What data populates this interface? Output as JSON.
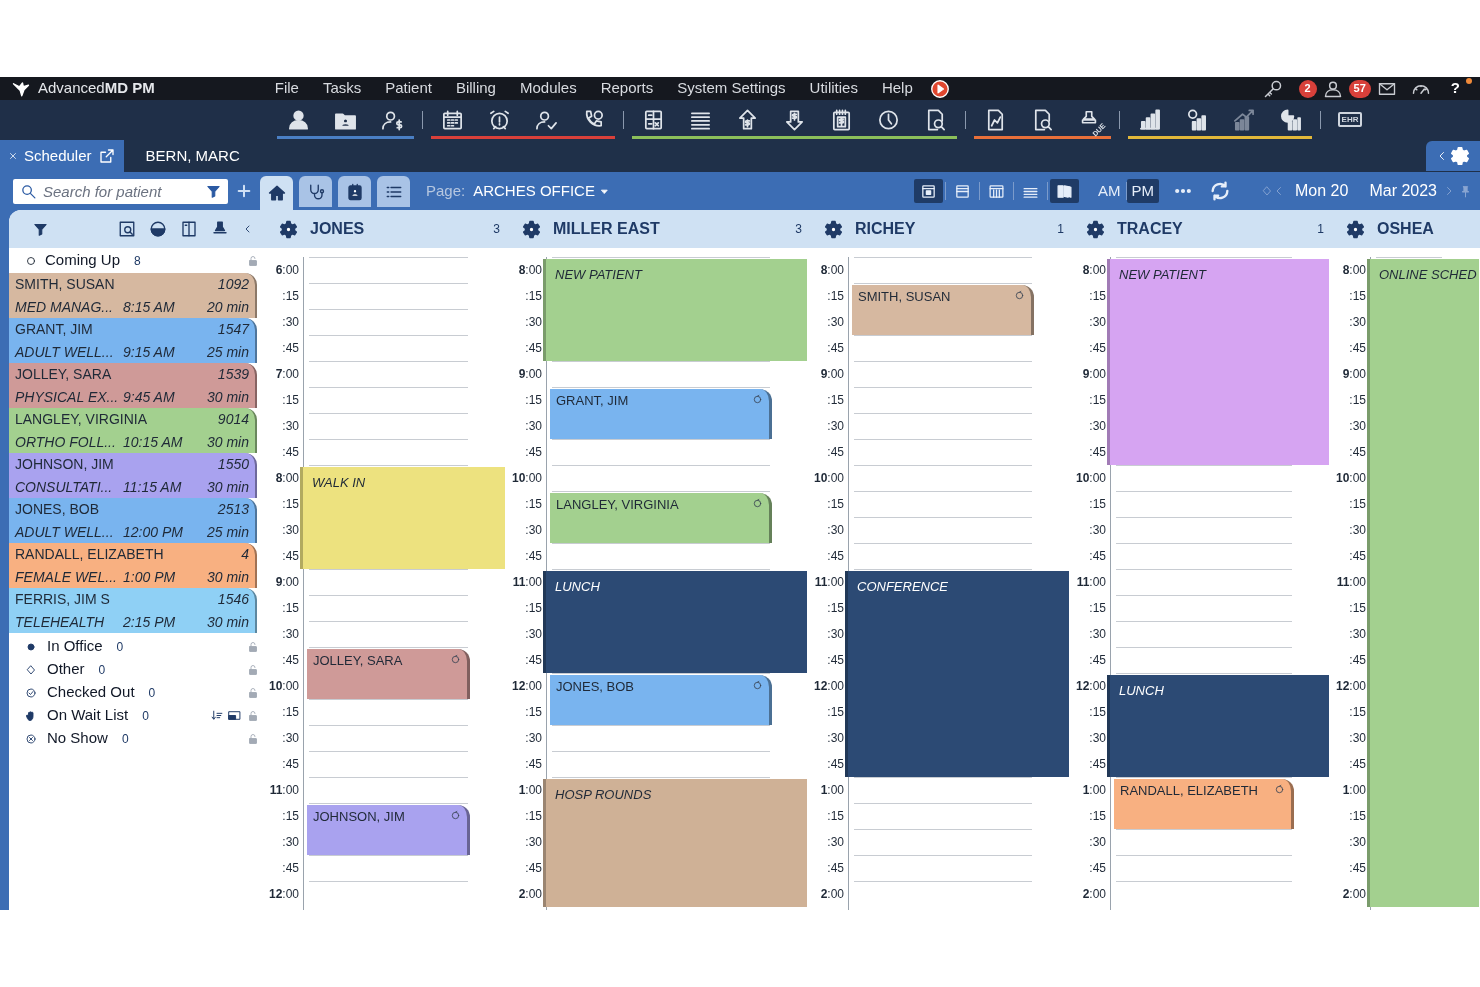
{
  "window": {
    "brand": "Advanced**MD PM**"
  },
  "menu": [
    "File",
    "Tasks",
    "Patient",
    "Billing",
    "Modules",
    "Reports",
    "System Settings",
    "Utilities",
    "Help"
  ],
  "alerts": {
    "tasks_badge": "2",
    "messages_badge": "57",
    "help": "?"
  },
  "toolbar": [
    {
      "color": "#4a7fc4",
      "items": [
        {
          "kind": "person"
        },
        {
          "kind": "folder"
        },
        {
          "kind": "user-dollar"
        }
      ]
    },
    {
      "color": "#d9403a",
      "items": [
        {
          "kind": "calendar"
        },
        {
          "kind": "alarm"
        },
        {
          "kind": "user-check"
        },
        {
          "kind": "phone"
        }
      ]
    },
    {
      "color": "#8bbf5a",
      "items": [
        {
          "kind": "calculator"
        },
        {
          "kind": "list"
        },
        {
          "kind": "upload"
        },
        {
          "kind": "download"
        },
        {
          "kind": "receipt"
        },
        {
          "kind": "clock"
        },
        {
          "kind": "doc-search"
        }
      ]
    },
    {
      "color": "#e8703a",
      "items": [
        {
          "kind": "doc-edit"
        },
        {
          "kind": "doc-search"
        },
        {
          "kind": "stamp",
          "label": "DUE"
        }
      ]
    },
    {
      "color": "#e2b83a",
      "items": [
        {
          "kind": "bars"
        },
        {
          "kind": "clock-bars"
        },
        {
          "kind": "trend"
        },
        {
          "kind": "pie-bars"
        }
      ]
    },
    {
      "items": [
        {
          "kind": "monitor",
          "label": "EHR"
        }
      ]
    }
  ],
  "tabs": [
    {
      "label": "Scheduler",
      "selected": true
    },
    {
      "label": "BERN, MARC",
      "selected": false
    }
  ],
  "search": {
    "placeholder": "Search for patient"
  },
  "views": [
    {
      "kind": "home",
      "selected": true
    },
    {
      "kind": "stethoscope",
      "selected": false
    },
    {
      "kind": "card",
      "selected": false
    },
    {
      "kind": "list",
      "selected": false
    }
  ],
  "page": {
    "label": "Page:",
    "value": "ARCHES OFFICE"
  },
  "layouts": [
    {
      "kind": "day",
      "selected": true
    },
    {
      "kind": "row",
      "selected": false
    },
    {
      "kind": "week",
      "selected": false
    },
    {
      "kind": "stack",
      "selected": false
    },
    {
      "kind": "book",
      "selected": true
    }
  ],
  "period": [
    {
      "label": "AM",
      "selected": false
    },
    {
      "label": "PM",
      "selected": true
    }
  ],
  "date": {
    "day": "Mon 20",
    "month": "Mar 2023"
  },
  "sidebar": {
    "coming_up": {
      "label": "Coming Up",
      "count": "8"
    },
    "appointments": [
      {
        "name": "SMITH, SUSAN",
        "number": "1092",
        "type": "MED MANAG...",
        "time": "8:15 AM",
        "duration": "20 min",
        "color": "#d6b8a0"
      },
      {
        "name": "GRANT, JIM",
        "number": "1547",
        "type": "ADULT WELL...",
        "time": "9:15 AM",
        "duration": "25 min",
        "color": "#79b4ef"
      },
      {
        "name": "JOLLEY, SARA",
        "number": "1539",
        "type": "PHYSICAL EX...",
        "time": "9:45 AM",
        "duration": "30 min",
        "color": "#cf9a98"
      },
      {
        "name": "LANGLEY, VIRGINIA",
        "number": "9014",
        "type": "ORTHO FOLL...",
        "time": "10:15 AM",
        "duration": "30 min",
        "color": "#a3d08f"
      },
      {
        "name": "JOHNSON, JIM",
        "number": "1550",
        "type": "CONSULTATI...",
        "time": "11:15 AM",
        "duration": "30 min",
        "color": "#a9a2ef"
      },
      {
        "name": "JONES, BOB",
        "number": "2513",
        "type": "ADULT WELL...",
        "time": "12:00 PM",
        "duration": "25 min",
        "color": "#79b4ef"
      },
      {
        "name": "RANDALL, ELIZABETH",
        "number": "4",
        "type": "FEMALE WEL...",
        "time": "1:00 PM",
        "duration": "30 min",
        "color": "#f8b081"
      },
      {
        "name": "FERRIS, JIM S",
        "number": "1546",
        "type": "TELEHEALTH",
        "time": "2:15 PM",
        "duration": "30 min",
        "color": "#8fd0f5"
      }
    ],
    "statuses": [
      {
        "kind": "dot",
        "label": "In Office",
        "count": "0"
      },
      {
        "kind": "diamond",
        "label": "Other",
        "count": "0"
      },
      {
        "kind": "check",
        "label": "Checked Out",
        "count": "0"
      },
      {
        "kind": "hand",
        "label": "On Wait List",
        "count": "0"
      },
      {
        "kind": "cross",
        "label": "No Show",
        "count": "0"
      }
    ]
  },
  "providers": [
    {
      "name": "JONES",
      "count": "3",
      "slots": [
        {
          "time": "**6**:00"
        },
        {
          "time": ":15"
        },
        {
          "time": ":30"
        },
        {
          "time": ":45"
        },
        {
          "time": "**7**:00"
        },
        {
          "time": ":15"
        },
        {
          "time": ":30"
        },
        {
          "time": ":45"
        },
        {
          "time": "**8**:00",
          "appointment": {
            "kind": "block",
            "label": "WALK IN",
            "color": "#ede27f"
          }
        },
        {
          "time": ":15",
          "continues": true
        },
        {
          "time": ":30",
          "continues": true
        },
        {
          "time": ":45",
          "continues": true
        },
        {
          "time": "**9**:00"
        },
        {
          "time": ":15"
        },
        {
          "time": ":30"
        },
        {
          "time": ":45",
          "appointment": {
            "kind": "patient",
            "label": "JOLLEY, SARA",
            "color": "#cf9a98"
          }
        },
        {
          "time": "**10**:00",
          "continues": true
        },
        {
          "time": ":15"
        },
        {
          "time": ":30"
        },
        {
          "time": ":45"
        },
        {
          "time": "**11**:00"
        },
        {
          "time": ":15",
          "appointment": {
            "kind": "patient",
            "label": "JOHNSON, JIM",
            "color": "#a9a2ef"
          }
        },
        {
          "time": ":30",
          "continues": true
        },
        {
          "time": ":45"
        },
        {
          "time": "**12**:00"
        }
      ]
    },
    {
      "name": "MILLER EAST",
      "count": "3",
      "slots": [
        {
          "time": "**8**:00",
          "appointment": {
            "kind": "block",
            "label": "NEW PATIENT",
            "color": "#a3d08f"
          }
        },
        {
          "time": ":15",
          "continues": true
        },
        {
          "time": ":30",
          "continues": true
        },
        {
          "time": ":45",
          "continues": true
        },
        {
          "time": "**9**:00"
        },
        {
          "time": ":15",
          "appointment": {
            "kind": "patient",
            "label": "GRANT, JIM",
            "color": "#79b4ef"
          }
        },
        {
          "time": ":30",
          "continues": true
        },
        {
          "time": ":45"
        },
        {
          "time": "**10**:00"
        },
        {
          "time": ":15",
          "appointment": {
            "kind": "patient",
            "label": "LANGLEY, VIRGINIA",
            "color": "#a3d08f"
          }
        },
        {
          "time": ":30",
          "continues": true
        },
        {
          "time": ":45"
        },
        {
          "time": "**11**:00",
          "appointment": {
            "kind": "block",
            "label": "LUNCH",
            "color": "#2c4a74"
          }
        },
        {
          "time": ":15",
          "continues": true
        },
        {
          "time": ":30",
          "continues": true
        },
        {
          "time": ":45",
          "continues": true
        },
        {
          "time": "**12**:00",
          "appointment": {
            "kind": "patient",
            "label": "JONES, BOB",
            "color": "#79b4ef"
          }
        },
        {
          "time": ":15",
          "continues": true
        },
        {
          "time": ":30"
        },
        {
          "time": ":45"
        },
        {
          "time": "**1**:00",
          "appointment": {
            "kind": "block",
            "label": "HOSP ROUNDS",
            "color": "#cfb196"
          }
        },
        {
          "time": ":15",
          "continues": true
        },
        {
          "time": ":30",
          "continues": true
        },
        {
          "time": ":45",
          "continues": true
        },
        {
          "time": "**2**:00",
          "continues": true
        }
      ]
    },
    {
      "name": "RICHEY",
      "count": "1",
      "slots": [
        {
          "time": "**8**:00"
        },
        {
          "time": ":15",
          "appointment": {
            "kind": "patient",
            "label": "SMITH, SUSAN",
            "color": "#d6b8a0"
          }
        },
        {
          "time": ":30",
          "continues": true
        },
        {
          "time": ":45"
        },
        {
          "time": "**9**:00"
        },
        {
          "time": ":15"
        },
        {
          "time": ":30"
        },
        {
          "time": ":45"
        },
        {
          "time": "**10**:00"
        },
        {
          "time": ":15"
        },
        {
          "time": ":30"
        },
        {
          "time": ":45"
        },
        {
          "time": "**11**:00",
          "appointment": {
            "kind": "block",
            "label": "CONFERENCE",
            "color": "#2c4a74"
          }
        },
        {
          "time": ":15",
          "continues": true
        },
        {
          "time": ":30",
          "continues": true
        },
        {
          "time": ":45",
          "continues": true
        },
        {
          "time": "**12**:00",
          "continues": true
        },
        {
          "time": ":15",
          "continues": true
        },
        {
          "time": ":30",
          "continues": true
        },
        {
          "time": ":45",
          "continues": true
        },
        {
          "time": "**1**:00"
        },
        {
          "time": ":15"
        },
        {
          "time": ":30"
        },
        {
          "time": ":45"
        },
        {
          "time": "**2**:00"
        }
      ]
    },
    {
      "name": "TRACEY",
      "count": "1",
      "slots": [
        {
          "time": "**8**:00",
          "appointment": {
            "kind": "block",
            "label": "NEW PATIENT",
            "color": "#d6a4f2"
          }
        },
        {
          "time": ":15",
          "continues": true
        },
        {
          "time": ":30",
          "continues": true
        },
        {
          "time": ":45",
          "continues": true
        },
        {
          "time": "**9**:00",
          "continues": true
        },
        {
          "time": ":15",
          "continues": true
        },
        {
          "time": ":30",
          "continues": true
        },
        {
          "time": ":45",
          "continues": true
        },
        {
          "time": "**10**:00"
        },
        {
          "time": ":15"
        },
        {
          "time": ":30"
        },
        {
          "time": ":45"
        },
        {
          "time": "**11**:00"
        },
        {
          "time": ":15"
        },
        {
          "time": ":30"
        },
        {
          "time": ":45"
        },
        {
          "time": "**12**:00",
          "appointment": {
            "kind": "block",
            "label": "LUNCH",
            "color": "#2c4a74"
          }
        },
        {
          "time": ":15",
          "continues": true
        },
        {
          "time": ":30",
          "continues": true
        },
        {
          "time": ":45",
          "continues": true
        },
        {
          "time": "**1**:00",
          "appointment": {
            "kind": "patient",
            "label": "RANDALL, ELIZABETH",
            "color": "#f8b081"
          }
        },
        {
          "time": ":15",
          "continues": true
        },
        {
          "time": ":30"
        },
        {
          "time": ":45"
        },
        {
          "time": "**2**:00"
        }
      ]
    },
    {
      "name": "OSHEA",
      "slots": [
        {
          "time": "**8**:00",
          "appointment": {
            "kind": "block",
            "label": "ONLINE SCHED",
            "color": "#a3d08f"
          }
        },
        {
          "time": ":15",
          "continues": true
        },
        {
          "time": ":30",
          "continues": true
        },
        {
          "time": ":45",
          "continues": true
        },
        {
          "time": "**9**:00",
          "continues": true
        },
        {
          "time": ":15",
          "continues": true
        },
        {
          "time": ":30",
          "continues": true
        },
        {
          "time": ":45",
          "continues": true
        },
        {
          "time": "**10**:00",
          "continues": true
        },
        {
          "time": ":15",
          "continues": true
        },
        {
          "time": ":30",
          "continues": true
        },
        {
          "time": ":45",
          "continues": true
        },
        {
          "time": "**11**:00",
          "continues": true
        },
        {
          "time": ":15",
          "continues": true
        },
        {
          "time": ":30",
          "continues": true
        },
        {
          "time": ":45",
          "continues": true
        },
        {
          "time": "**12**:00",
          "continues": true
        },
        {
          "time": ":15",
          "continues": true
        },
        {
          "time": ":30",
          "continues": true
        },
        {
          "time": ":45",
          "continues": true
        },
        {
          "time": "**1**:00",
          "continues": true
        },
        {
          "time": ":15",
          "continues": true
        },
        {
          "time": ":30",
          "continues": true
        },
        {
          "time": ":45",
          "continues": true
        },
        {
          "time": "**2**:00",
          "continues": true
        }
      ]
    }
  ]
}
